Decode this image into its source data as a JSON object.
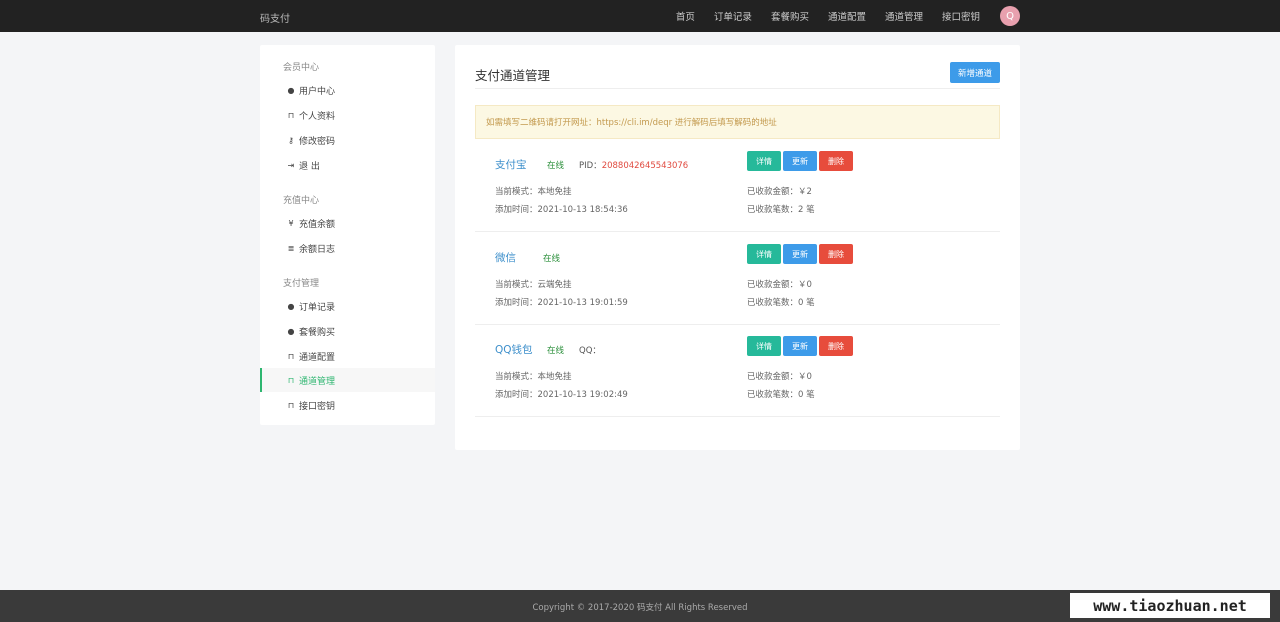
{
  "topbar": {
    "brand": "码支付",
    "nav": [
      "首页",
      "订单记录",
      "套餐购买",
      "通道配置",
      "通道管理",
      "接口密钥"
    ],
    "avatar": "Q"
  },
  "sidebar": {
    "groups": [
      {
        "title": "会员中心",
        "items": [
          {
            "label": "用户中心",
            "icon": "user-circle-icon",
            "glyph": "●"
          },
          {
            "label": "个人资料",
            "icon": "lock-icon",
            "glyph": "⊓"
          },
          {
            "label": "修改密码",
            "icon": "key-icon",
            "glyph": "⚷"
          },
          {
            "label": "退 出",
            "icon": "logout-icon",
            "glyph": "⇥"
          }
        ]
      },
      {
        "title": "充值中心",
        "items": [
          {
            "label": "充值余额",
            "icon": "yen-icon",
            "glyph": "¥"
          },
          {
            "label": "余额日志",
            "icon": "list-icon",
            "glyph": "≣"
          }
        ]
      },
      {
        "title": "支付管理",
        "items": [
          {
            "label": "订单记录",
            "icon": "user-circle-icon",
            "glyph": "●"
          },
          {
            "label": "套餐购买",
            "icon": "user-circle-icon",
            "glyph": "●"
          },
          {
            "label": "通道配置",
            "icon": "lock-icon",
            "glyph": "⊓"
          },
          {
            "label": "通道管理",
            "icon": "lock-icon",
            "glyph": "⊓",
            "active": true
          },
          {
            "label": "接口密钥",
            "icon": "lock-icon",
            "glyph": "⊓"
          }
        ]
      }
    ]
  },
  "main": {
    "title": "支付通道管理",
    "new_button": "新增通道",
    "notice": "如需填写二维码请打开网址：https://cli.im/deqr 进行解码后填写解码的地址",
    "actions": {
      "detail": "详情",
      "update": "更新",
      "delete": "删除"
    },
    "channels": [
      {
        "name": "支付宝",
        "status": "在线",
        "pid_label": "PID：",
        "pid_value": "2088042645543076",
        "mode": "当前模式：本地免挂",
        "added": "添加时间：2021-10-13 18:54:36",
        "amount": "已收款金额：￥2",
        "count": "已收款笔数：2 笔"
      },
      {
        "name": "微信",
        "status": "在线",
        "pid_label": "",
        "pid_value": "",
        "mode": "当前模式：云端免挂",
        "added": "添加时间：2021-10-13 19:01:59",
        "amount": "已收款金额：￥0",
        "count": "已收款笔数：0 笔"
      },
      {
        "name": "QQ钱包",
        "status": "在线",
        "pid_label": "QQ：",
        "pid_value": "",
        "mode": "当前模式：本地免挂",
        "added": "添加时间：2021-10-13 19:02:49",
        "amount": "已收款金额：￥0",
        "count": "已收款笔数：0 笔"
      }
    ]
  },
  "footer": {
    "copyright": "Copyright © 2017-2020 码支付 All Rights Reserved",
    "watermark": "www.tiaozhuan.net"
  },
  "colors": {
    "accent_green": "#2eb670",
    "btn_blue": "#3d9be9",
    "btn_teal": "#26b99a",
    "btn_red": "#e74c3c"
  }
}
